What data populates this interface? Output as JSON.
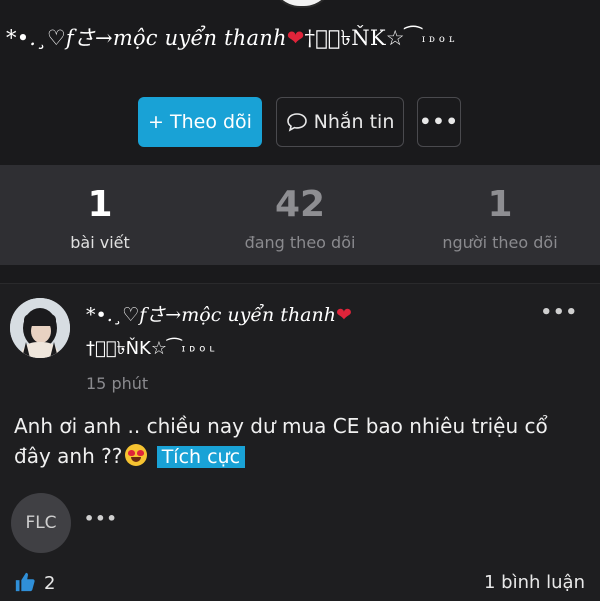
{
  "profile": {
    "name_part1": "*•.¸♡fさ→mộc uyển thanh",
    "name_part2": "†ঔ⃝৳ŇK☆⁀",
    "name_idol": "ɪᴅᴏʟ"
  },
  "actions": {
    "follow_label": "+ Theo dõi",
    "message_label": "Nhắn tin",
    "more_label": "•••"
  },
  "stats": [
    {
      "value": "1",
      "label": "bài viết"
    },
    {
      "value": "42",
      "label": "đang theo dõi"
    },
    {
      "value": "1",
      "label": "người theo dõi"
    }
  ],
  "post": {
    "author_line1": "*•.¸♡fさ→mộc uyển thanh",
    "author_line2": "†ঔ⃝৳ŇK☆⁀",
    "author_idol": "ɪᴅᴏʟ",
    "time": "15 phút",
    "text_before": "Anh ơi anh .. chiều nay dư mua CE bao nhiêu triệu cổ đây anh ??",
    "tag": "Tích cực",
    "commenter_initials": "FLC",
    "menu_label": "•••",
    "comment_more": "•••",
    "like_count": "2",
    "comment_count": "1 bình luận"
  },
  "icons": {
    "heart": "heart-icon",
    "plus": "plus-icon",
    "chat": "chat-bubble-icon",
    "like": "thumbs-up-icon"
  },
  "colors": {
    "accent": "#19a2d6",
    "background": "#1a1a1c",
    "stats_background": "#2f2f33",
    "heart": "#e0243a"
  }
}
